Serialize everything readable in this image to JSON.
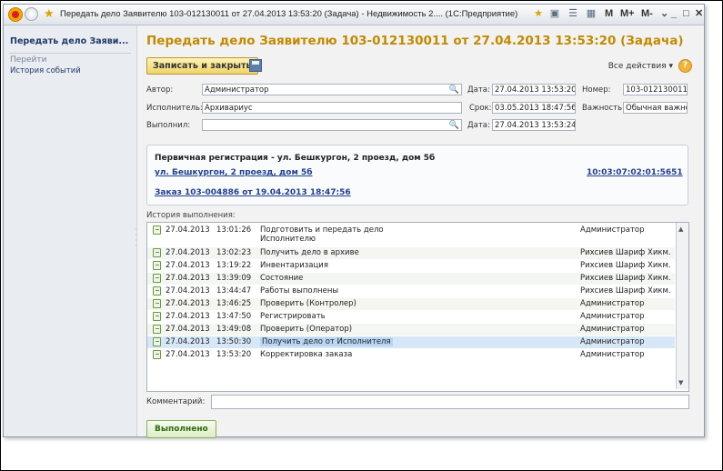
{
  "titlebar": {
    "title": "Передать дело Заявителю 103-012130011 от 27.04.2013 13:53:20 (Задача) - Недвижимость 2.... (1С:Предприятие)",
    "btn_m": "M",
    "btn_mplus": "M+",
    "btn_mminus": "M-",
    "btn_min": "_",
    "btn_max": "□",
    "btn_close": "✕"
  },
  "sidebar": {
    "title": "Передать дело Заяви...",
    "goto_label": "Перейти",
    "history_link": "История событий"
  },
  "form": {
    "title": "Передать дело Заявителю 103-012130011 от 27.04.2013 13:53:20 (Задача)",
    "save_close": "Записать и закрыть",
    "all_actions": "Все действия ▾",
    "help": "?",
    "author_label": "Автор:",
    "author_value": "Администратор",
    "executor_label": "Исполнитель:",
    "executor_value": "Архивариус",
    "done_by_label": "Выполнил:",
    "done_by_value": "",
    "date_label": "Дата:",
    "date_value": "27.04.2013 13:53:20",
    "due_label": "Срок:",
    "due_value": "03.05.2013 18:47:56",
    "done_date_label": "Дата:",
    "done_date_value": "27.04.2013 13:53:24",
    "number_label": "Номер:",
    "number_value": "103-012130011",
    "importance_label": "Важность:",
    "importance_value": "Обычная важност"
  },
  "info": {
    "title": "Первичная регистрация - ул. Бешкургон, 2 проезд, дом 5б",
    "address_link": "ул. Бешкургон, 2 проезд, дом 5б",
    "code_link": "10:03:07:02:01:5651",
    "order_link": "Заказ 103-004886 от 19.04.2013 18:47:56"
  },
  "history": {
    "label": "История выполнения:",
    "rows": [
      {
        "date": "27.04.2013",
        "time": "13:01:26",
        "name": "Подготовить и передать дело Исполнителю",
        "author": "Администратор"
      },
      {
        "date": "27.04.2013",
        "time": "13:02:23",
        "name": "Получить дело в архиве",
        "author": "Рихсиев Шариф Хикм..."
      },
      {
        "date": "27.04.2013",
        "time": "13:19:22",
        "name": "Инвентаризация",
        "author": "Рихсиев Шариф Хикм..."
      },
      {
        "date": "27.04.2013",
        "time": "13:39:09",
        "name": "Состояние",
        "author": "Рихсиев Шариф Хикм..."
      },
      {
        "date": "27.04.2013",
        "time": "13:44:47",
        "name": "Работы выполнены",
        "author": "Рихсиев Шариф Хикм..."
      },
      {
        "date": "27.04.2013",
        "time": "13:46:25",
        "name": "Проверить (Контролер)",
        "author": "Администратор"
      },
      {
        "date": "27.04.2013",
        "time": "13:47:50",
        "name": "Регистрировать",
        "author": "Администратор"
      },
      {
        "date": "27.04.2013",
        "time": "13:49:08",
        "name": "Проверить (Оператор)",
        "author": "Администратор"
      },
      {
        "date": "27.04.2013",
        "time": "13:50:30",
        "name": "Получить дело от Исполнителя",
        "author": "Администратор"
      },
      {
        "date": "27.04.2013",
        "time": "13:53:20",
        "name": "Корректировка заказа",
        "author": "Администратор"
      }
    ]
  },
  "comment_label": "Комментарий:",
  "done_button": "Выполнено"
}
